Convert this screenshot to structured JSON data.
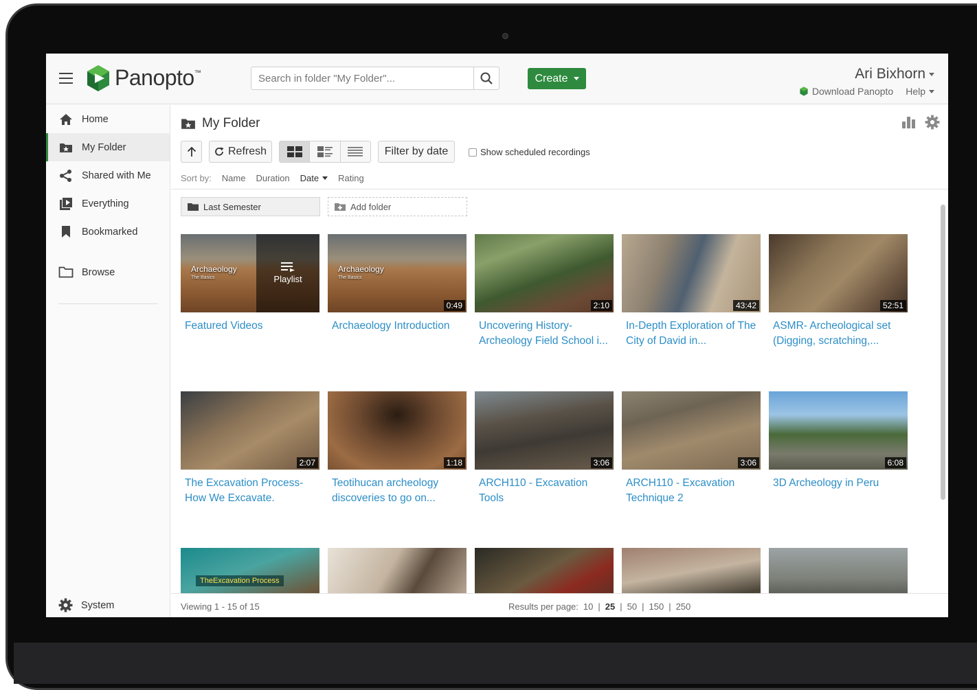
{
  "header": {
    "brand": "Panopto",
    "brand_tm": "™",
    "search_placeholder": "Search in folder \"My Folder\"...",
    "create_label": "Create",
    "user_name": "Ari Bixhorn",
    "download_label": "Download Panopto",
    "help_label": "Help",
    "accent_color": "#2d8a3e"
  },
  "sidebar": {
    "items": [
      {
        "label": "Home",
        "icon": "home-icon"
      },
      {
        "label": "My Folder",
        "icon": "folder-star-icon",
        "active": true
      },
      {
        "label": "Shared with Me",
        "icon": "share-icon"
      },
      {
        "label": "Everything",
        "icon": "video-stack-icon"
      },
      {
        "label": "Bookmarked",
        "icon": "bookmark-icon"
      },
      {
        "label": "Browse",
        "icon": "folder-icon"
      }
    ],
    "system_label": "System"
  },
  "main": {
    "folder_title": "My Folder",
    "refresh_label": "Refresh",
    "filter_label": "Filter by date",
    "scheduled_label": "Show scheduled recordings",
    "sort_label": "Sort by:",
    "sort_options": [
      "Name",
      "Duration",
      "Date",
      "Rating"
    ],
    "sort_active": "Date",
    "subfolder_label": "Last Semester",
    "add_folder_label": "Add folder",
    "playlist_label": "Playlist"
  },
  "videos": [
    {
      "title": "Featured Videos",
      "duration": "",
      "thumb_text": "Archaeology",
      "thumb_sub": "The Basics"
    },
    {
      "title": "Archaeology Introduction",
      "duration": "0:49",
      "thumb_text": "Archaeology",
      "thumb_sub": "The Basics"
    },
    {
      "title": "Uncovering History- Archeology Field School i...",
      "duration": "2:10"
    },
    {
      "title": "In-Depth Exploration of The City of David in...",
      "duration": "43:42"
    },
    {
      "title": "ASMR- Archeological set (Digging, scratching,...",
      "duration": "52:51"
    },
    {
      "title": "The Excavation Process- How We Excavate.",
      "duration": "2:07"
    },
    {
      "title": "Teotihucan archeology discoveries to go on...",
      "duration": "1:18"
    },
    {
      "title": "ARCH110 - Excavation Tools",
      "duration": "3:06"
    },
    {
      "title": "ARCH110 - Excavation Technique 2",
      "duration": "3:06"
    },
    {
      "title": "3D Archeology in Peru",
      "duration": "6:08"
    },
    {
      "title": "",
      "duration": "",
      "thumb_text": "TheExcavation Process"
    },
    {
      "title": "",
      "duration": ""
    },
    {
      "title": "",
      "duration": ""
    },
    {
      "title": "",
      "duration": ""
    },
    {
      "title": "",
      "duration": ""
    }
  ],
  "footer": {
    "viewing": "Viewing 1 - 15 of 15",
    "per_page_label": "Results per page:",
    "per_page_options": [
      "10",
      "25",
      "50",
      "150",
      "250"
    ],
    "per_page_active": "25"
  }
}
